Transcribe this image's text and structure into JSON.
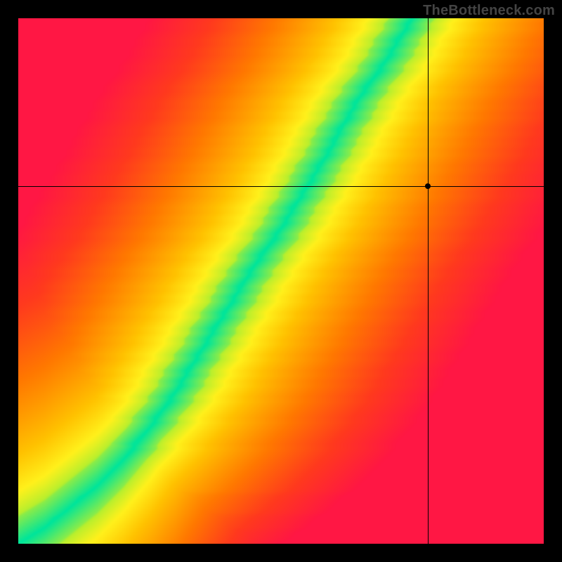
{
  "watermark": "TheBottleneck.com",
  "chart_data": {
    "type": "heatmap",
    "title": "",
    "xlabel": "",
    "ylabel": "",
    "xlim": [
      0,
      100
    ],
    "ylim": [
      0,
      100
    ],
    "grid": false,
    "legend": false,
    "description": "Compatibility heatmap. Green diagonal band indicates optimal match; warm yellow/orange regions indicate mild mismatch; red regions indicate strong bottleneck.",
    "optimal_curve_points": [
      {
        "x": 0,
        "y": 0
      },
      {
        "x": 5,
        "y": 3
      },
      {
        "x": 10,
        "y": 7
      },
      {
        "x": 15,
        "y": 11
      },
      {
        "x": 20,
        "y": 16
      },
      {
        "x": 25,
        "y": 22
      },
      {
        "x": 30,
        "y": 29
      },
      {
        "x": 35,
        "y": 37
      },
      {
        "x": 40,
        "y": 45
      },
      {
        "x": 45,
        "y": 53
      },
      {
        "x": 50,
        "y": 60
      },
      {
        "x": 55,
        "y": 68
      },
      {
        "x": 60,
        "y": 76
      },
      {
        "x": 62,
        "y": 80
      },
      {
        "x": 65,
        "y": 85
      },
      {
        "x": 70,
        "y": 92
      },
      {
        "x": 75,
        "y": 100
      }
    ],
    "band_halfwidth_y": 5,
    "color_stops": [
      {
        "d": 0.0,
        "color": "#00e59b"
      },
      {
        "d": 0.08,
        "color": "#b8ef2e"
      },
      {
        "d": 0.18,
        "color": "#fff11c"
      },
      {
        "d": 0.32,
        "color": "#ffc100"
      },
      {
        "d": 0.55,
        "color": "#ff7a00"
      },
      {
        "d": 0.78,
        "color": "#ff3a1e"
      },
      {
        "d": 1.0,
        "color": "#ff1744"
      }
    ],
    "marker": {
      "x": 78,
      "y": 68
    },
    "crosshair": {
      "x": 78,
      "y": 68
    }
  }
}
